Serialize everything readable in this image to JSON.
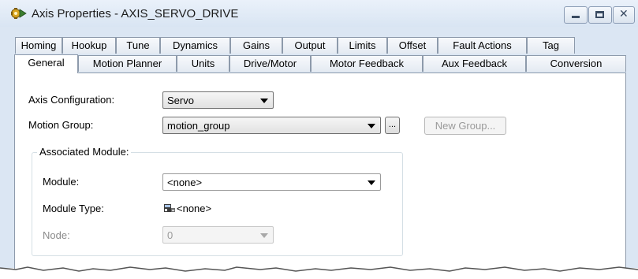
{
  "window": {
    "title": "Axis Properties - AXIS_SERVO_DRIVE",
    "icon": "axis-properties-icon"
  },
  "tabs_row1": [
    "Homing",
    "Hookup",
    "Tune",
    "Dynamics",
    "Gains",
    "Output",
    "Limits",
    "Offset",
    "Fault Actions",
    "Tag"
  ],
  "tabs_row2": [
    "General",
    "Motion Planner",
    "Units",
    "Drive/Motor",
    "Motor Feedback",
    "Aux Feedback",
    "Conversion"
  ],
  "active_tab": "General",
  "general": {
    "axis_configuration_label": "Axis Configuration:",
    "axis_configuration_value": "Servo",
    "motion_group_label": "Motion Group:",
    "motion_group_value": "motion_group",
    "browse_label": "...",
    "new_group_label": "New Group...",
    "associated_module_title": "Associated Module:",
    "module_label": "Module:",
    "module_value": "<none>",
    "module_type_label": "Module Type:",
    "module_type_value": "<none>",
    "node_label": "Node:",
    "node_value": "0"
  }
}
